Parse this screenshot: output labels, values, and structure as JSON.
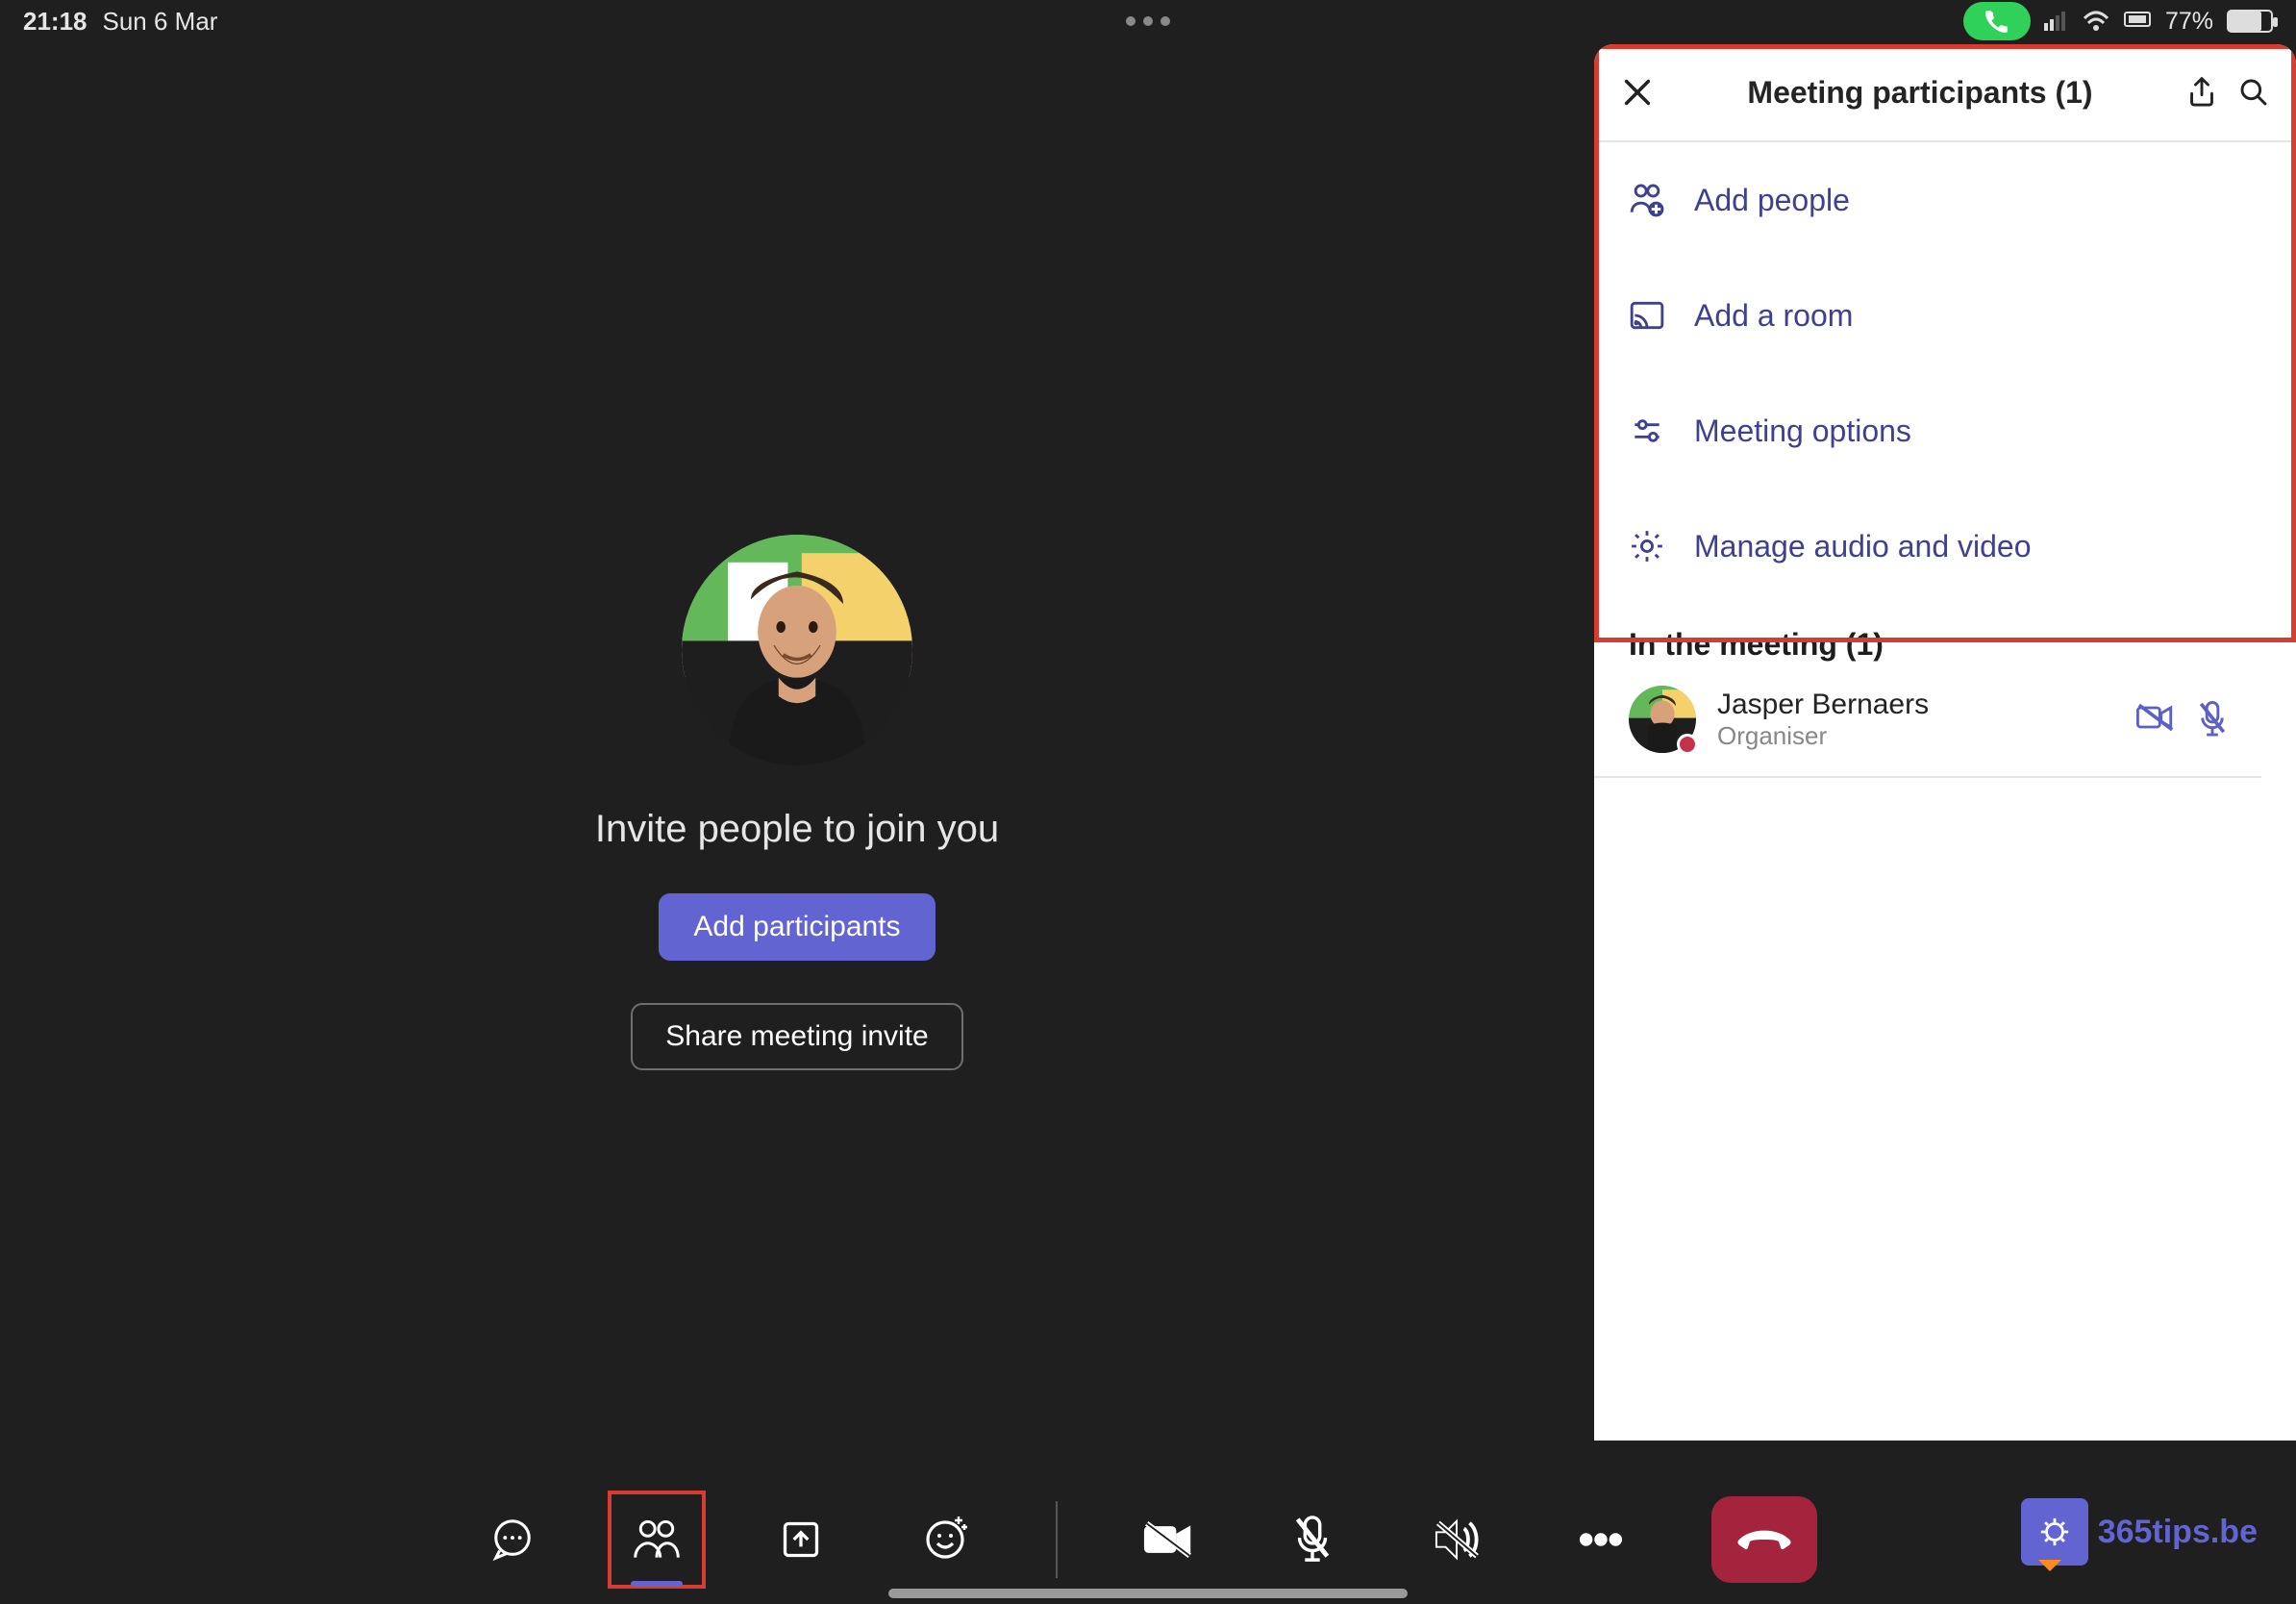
{
  "statusbar": {
    "time": "21:18",
    "date": "Sun 6 Mar",
    "battery_pct": "77%"
  },
  "main": {
    "invite_title": "Invite people to join you",
    "add_participants_label": "Add participants",
    "share_invite_label": "Share meeting invite"
  },
  "panel": {
    "title": "Meeting participants (1)",
    "items": [
      {
        "label": "Add people"
      },
      {
        "label": "Add a room"
      },
      {
        "label": "Meeting options"
      },
      {
        "label": "Manage audio and video"
      }
    ],
    "section_title": "In the meeting (1)",
    "participant": {
      "name": "Jasper Bernaers",
      "role": "Organiser"
    }
  },
  "logo": {
    "text": "365tips.be"
  }
}
